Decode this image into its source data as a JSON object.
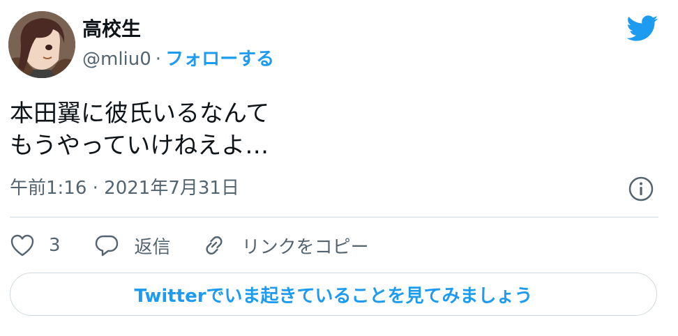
{
  "author": {
    "name": "高校生",
    "handle": "@mliu0",
    "separator": "·",
    "follow_label": "フォローする"
  },
  "tweet": {
    "lines": [
      "本田翼に彼氏いるなんて",
      "もうやっていけねえよ…"
    ],
    "timestamp": "午前1:16 · 2021年7月31日"
  },
  "actions": {
    "like_count": "3",
    "reply_label": "返信",
    "copy_link_label": "リンクをコピー"
  },
  "cta": {
    "label": "Twitterでいま起きていることを見てみましょう"
  },
  "icons": {
    "brand": "twitter-bird-icon",
    "info": "info-icon",
    "like": "heart-icon",
    "reply": "speech-bubble-icon",
    "copy_link": "link-icon"
  },
  "colors": {
    "accent": "#1d9bf0",
    "text": "#0f1419",
    "muted": "#536471",
    "border": "#cfd9de"
  }
}
